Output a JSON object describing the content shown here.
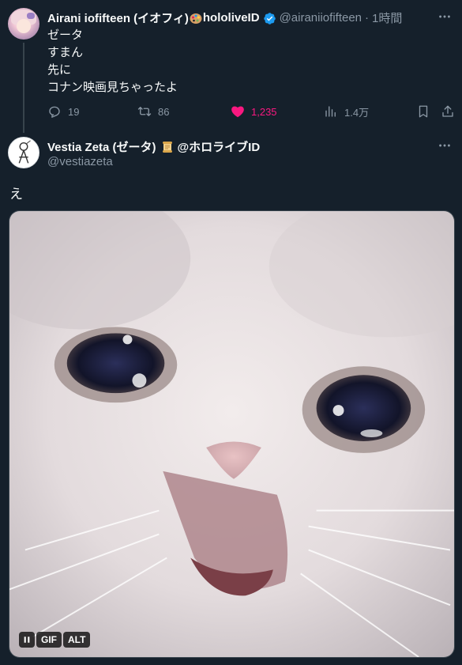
{
  "tweet1": {
    "display_name": "Airani iofifteen (イオフィ)",
    "name_suffix": "hololiveID",
    "handle": "@airaniiofifteen",
    "separator": "·",
    "time": "1時間",
    "lines": [
      "ゼータ",
      "すまん",
      "先に",
      "コナン映画見ちゃったよ"
    ],
    "replies": "19",
    "retweets": "86",
    "likes": "1,235",
    "views": "1.4万",
    "icons": [
      "reply-icon",
      "retweet-icon",
      "heart-icon",
      "views-icon",
      "bookmark-icon",
      "share-icon",
      "verified-icon",
      "palette-emoji",
      "more-icon"
    ]
  },
  "tweet2": {
    "display_name": "Vestia Zeta (ゼータ)",
    "name_suffix": "@ホロライブID",
    "handle": "@vestiazeta",
    "text": "え",
    "media": {
      "gif_label": "GIF",
      "alt_label": "ALT",
      "icons": [
        "pause-icon",
        "scroll-emoji",
        "more-icon"
      ]
    }
  },
  "colors": {
    "background": "#15202b",
    "text": "#f7f9f9",
    "secondary": "#8b98a5",
    "like": "#f91880",
    "verified": "#1d9bf0",
    "border": "#38444d"
  }
}
